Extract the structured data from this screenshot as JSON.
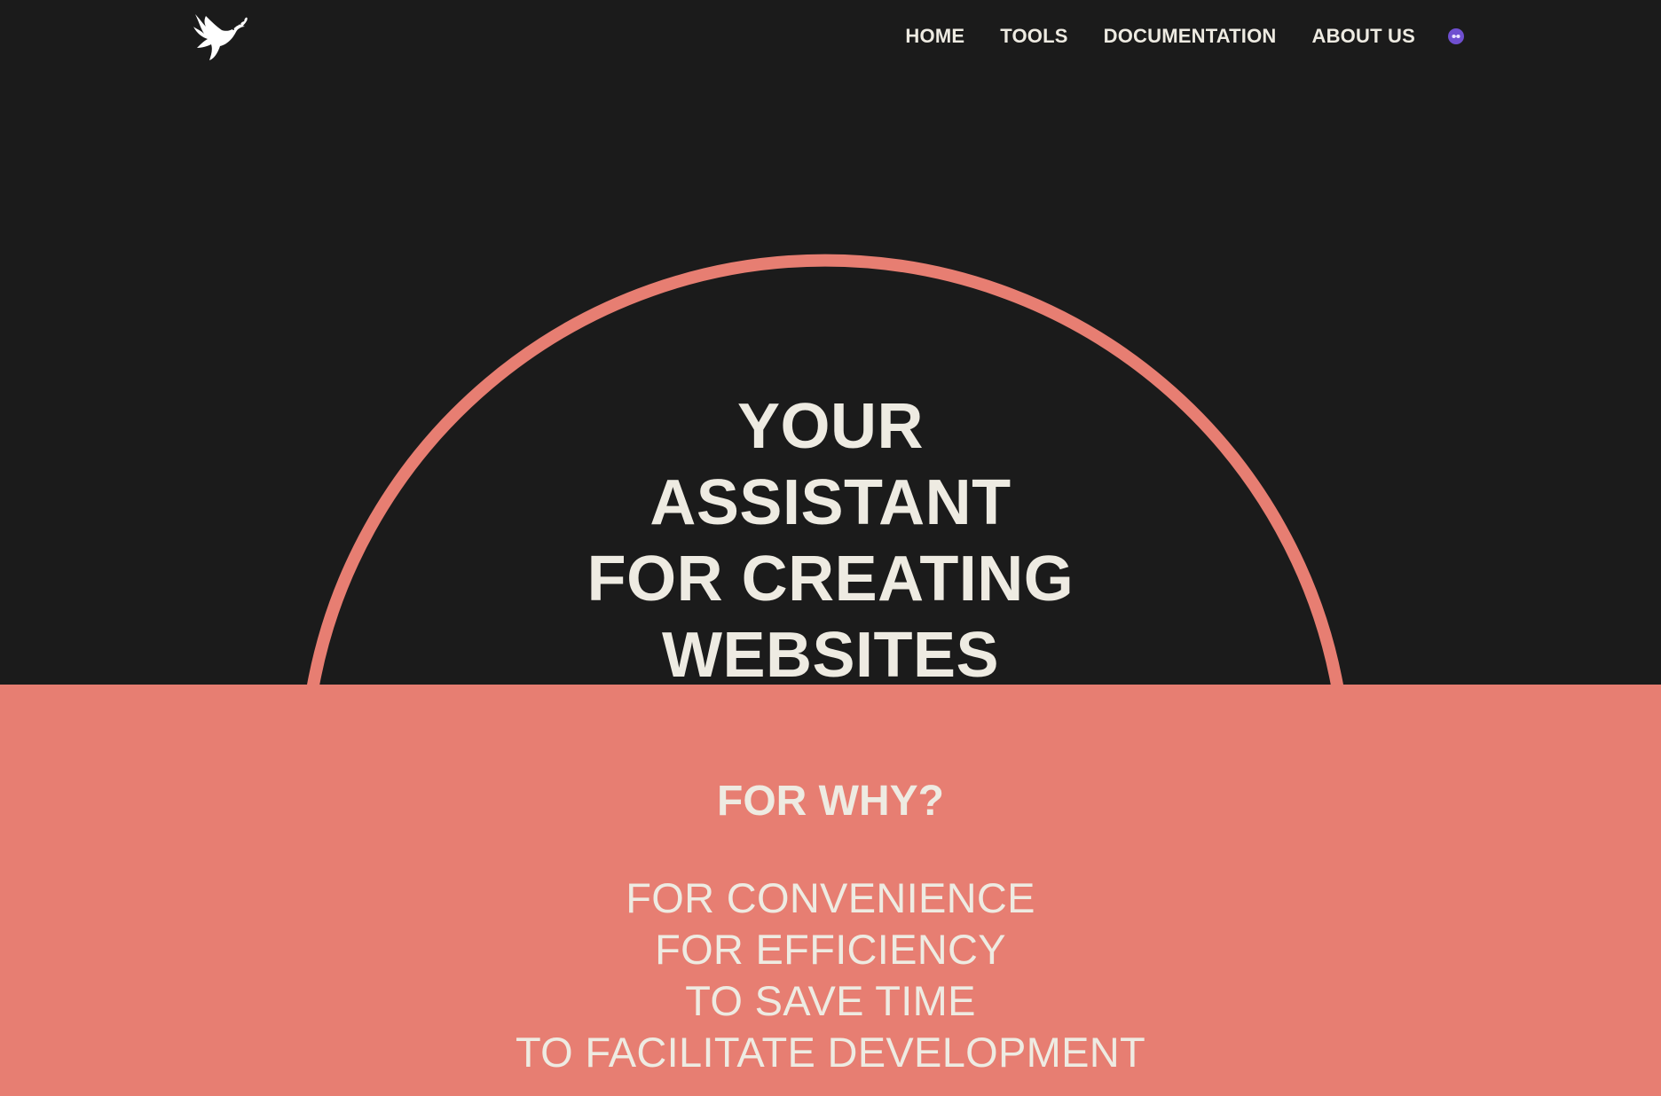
{
  "header": {
    "logo_icon": "dove-with-olive-branch-icon",
    "nav": [
      {
        "label": "HOME"
      },
      {
        "label": "TOOLS"
      },
      {
        "label": "DOCUMENTATION"
      },
      {
        "label": "ABOUT US"
      }
    ],
    "language_icon": "language-globe-icon"
  },
  "hero": {
    "title_lines": [
      "YOUR",
      "ASSISTANT",
      "FOR CREATING",
      "WEBSITES"
    ]
  },
  "why": {
    "heading": "FOR WHY?",
    "reasons": [
      "FOR CONVENIENCE",
      "FOR EFFICIENCY",
      "TO SAVE TIME",
      "TO FACILITATE DEVELOPMENT"
    ]
  },
  "colors": {
    "background": "#1b1b1b",
    "accent": "#e77e72",
    "text": "#eeebe2",
    "language_icon": "#6f4fd0"
  }
}
